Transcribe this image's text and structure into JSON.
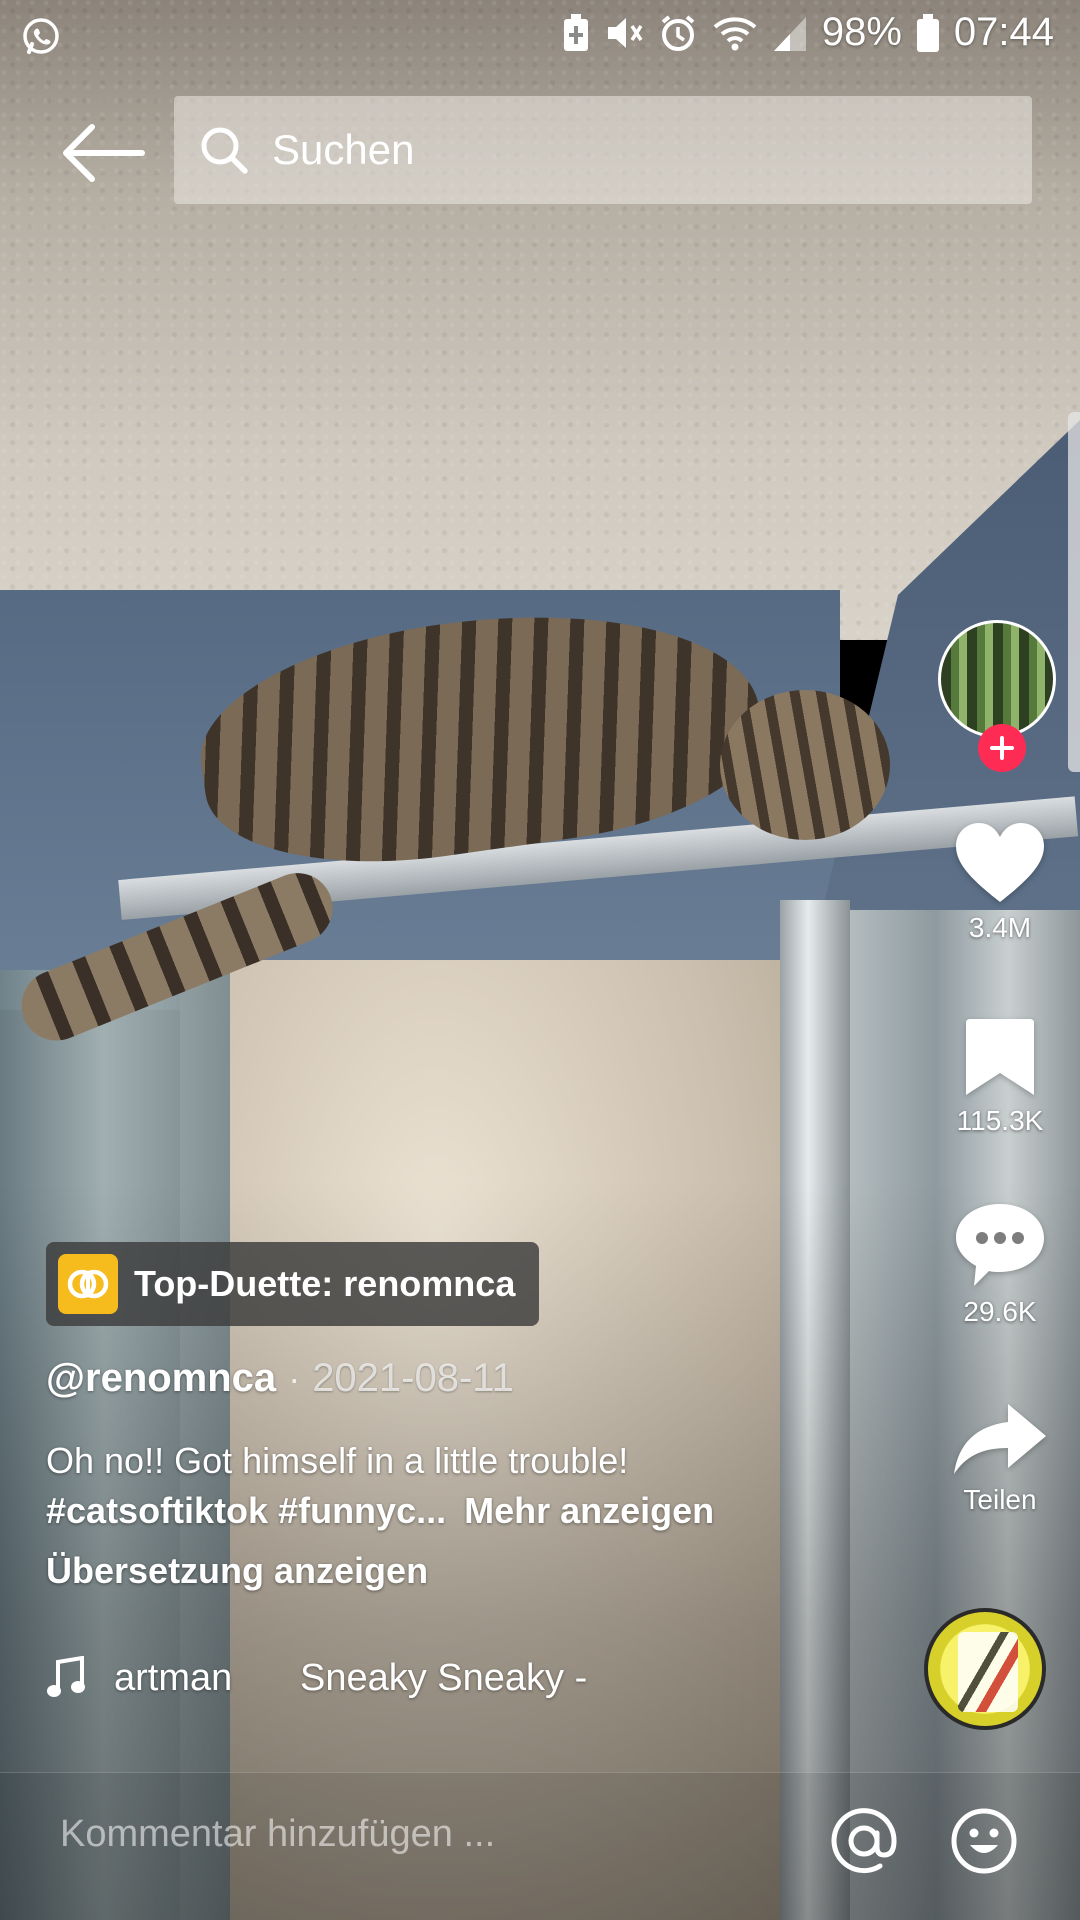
{
  "status_bar": {
    "battery_percent": "98%",
    "time": "07:44"
  },
  "search": {
    "placeholder": "Suchen"
  },
  "actions": {
    "likes": "3.4M",
    "saves": "115.3K",
    "comments": "29.6K",
    "share_label": "Teilen"
  },
  "duet": {
    "label": "Top-Duette: renomnca"
  },
  "post": {
    "author": "@renomnca",
    "separator": "·",
    "date": "2021-08-11",
    "caption_text": "Oh no!! Got himself in a little trouble!",
    "caption_tags": "#catsoftiktok #funnyc...",
    "more_label": "Mehr anzeigen",
    "translate_label": "Übersetzung anzeigen"
  },
  "music": {
    "artist_fragment": "artman",
    "track": "Sneaky Sneaky -"
  },
  "comment_bar": {
    "placeholder": "Kommentar hinzufügen ..."
  },
  "colors": {
    "follow_accent": "#fe2c55",
    "duet_icon_bg": "#f6bb1c"
  },
  "icons": {
    "whatsapp": "whatsapp-icon",
    "back": "arrow-left-icon",
    "search": "search-icon",
    "like": "heart-icon",
    "save": "bookmark-icon",
    "comment": "comment-icon",
    "share": "share-icon",
    "music": "music-note-icon",
    "mention": "at-sign-icon",
    "emoji": "emoji-icon"
  }
}
